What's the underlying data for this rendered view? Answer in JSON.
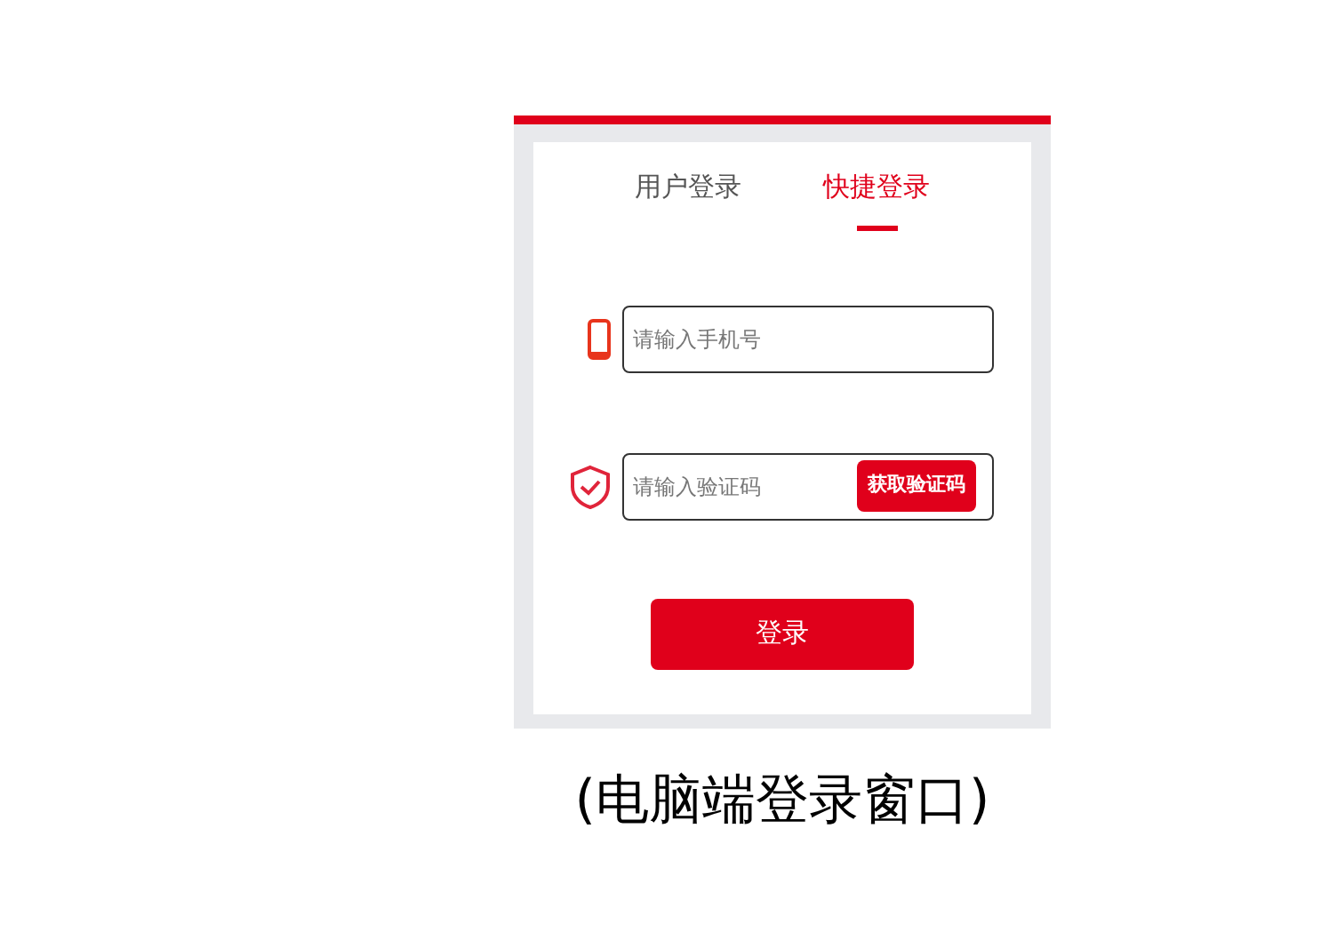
{
  "tabs": [
    {
      "label": "用户登录",
      "selected": false
    },
    {
      "label": "快捷登录",
      "selected": true
    }
  ],
  "fields": [
    {
      "kind": "phone",
      "placeholder": "请输入手机号"
    },
    {
      "kind": "code",
      "placeholder": "请输入验证码",
      "button": "获取验证码"
    }
  ],
  "submit": "登录",
  "caption": "(电脑端登录窗口)"
}
